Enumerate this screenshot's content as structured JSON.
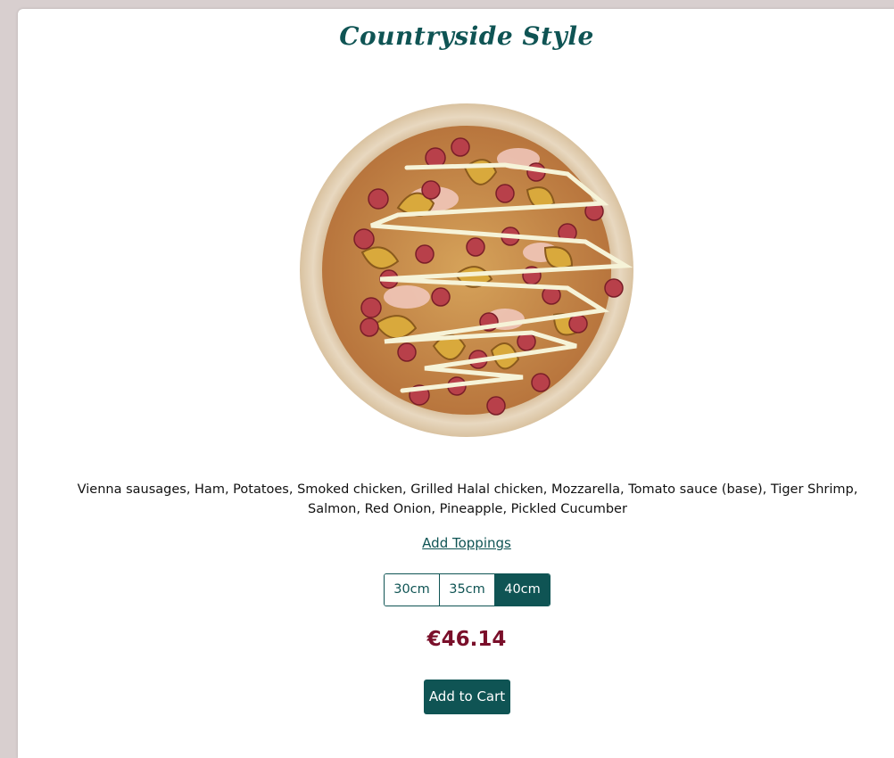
{
  "product": {
    "title": "Countryside Style",
    "image_alt": "Countryside Style pizza",
    "ingredients": "Vienna sausages, Ham, Potatoes, Smoked chicken, Grilled Halal chicken, Mozzarella, Tomato sauce (base), Tiger Shrimp, Salmon, Red Onion, Pineapple, Pickled Cucumber",
    "add_toppings_label": "Add Toppings",
    "sizes": [
      {
        "label": "30cm",
        "selected": false
      },
      {
        "label": "35cm",
        "selected": false
      },
      {
        "label": "40cm",
        "selected": true
      }
    ],
    "price": "€46.14",
    "add_to_cart_label": "Add to Cart"
  },
  "colors": {
    "accent": "#0f5454",
    "price": "#7a0f2a",
    "page_background": "#d8cfcf",
    "card_background": "#ffffff"
  }
}
